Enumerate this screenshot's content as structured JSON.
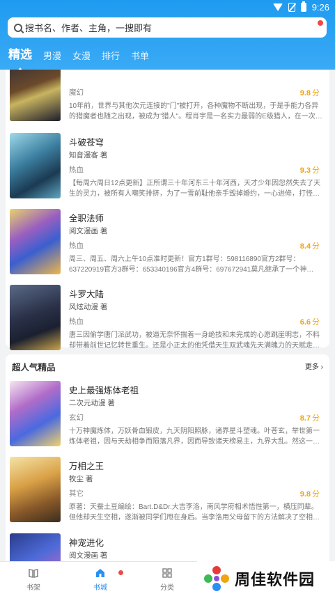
{
  "status": {
    "time": "9:26"
  },
  "search": {
    "placeholder": "搜书名、作者、主角，一搜即有"
  },
  "tabs": [
    "精选",
    "男漫",
    "女漫",
    "排行",
    "书单"
  ],
  "featured": [
    {
      "title": "",
      "author": "",
      "genre": "魔幻",
      "score": "9.8",
      "desc": "10年前，世界与其他次元连接的\"门\"被打开，各种魔物不断出现，于是手能力各异的猎魔者也随之出现，被成为\"猎人\"。程肖宇是一名实力最弱的E级猎人，在一次…"
    },
    {
      "title": "斗破苍穹",
      "author": "知音漫客 著",
      "genre": "热血",
      "score": "9.3",
      "desc": "【每周六周日12点更新】正所谓三十年河东三十年河西，天才少年因忽然失去了天生的灵力，被所有人嘲笑排挤，为了一雪前耻他亲手毁掉婚约，一心进修，打怪…"
    },
    {
      "title": "全职法师",
      "author": "阅文漫画 著",
      "genre": "热血",
      "score": "8.4",
      "desc": "周三、周五、周六上午10点准时更新！官方1群号：598116890官方2群号：637220919官方3群号：653340196官方4群号：697672941莫凡继承了一个神…"
    },
    {
      "title": "斗罗大陆",
      "author": "风炫动漫 著",
      "genre": "热血",
      "score": "6.6",
      "desc": "唐三因偷学唐门派武功，被逼无奈怀揣着一身绝技和未完成的心愿跳崖明志，不料却带着前世记忆转世重生。还是小正太的他凭借天生双武魂先天满魄力的天赋走…"
    }
  ],
  "popular": {
    "title": "超人气精品",
    "more": "更多",
    "books": [
      {
        "title": "史上最强炼体老祖",
        "author": "二次元动漫 著",
        "genre": "玄幻",
        "score": "8.7",
        "desc": "十万神魔炼体，万妖骨血锻皮，九天阴阳照脉，诸界星斗塑魂。叶苍玄，举世第一炼体老祖，因与天劫相争而陨落凡界，因而导致诸天榜易主，九界大乱。然这一…"
      },
      {
        "title": "万相之王",
        "author": "牧尘 著",
        "genre": "其它",
        "score": "9.8",
        "desc": "原著：天蚕土豆编绘：Bart.D&Dr.大吉李洛，南风学府相术悟性第一，横压同辈。但他却天生空相，遂渐被同学们甩在身后。当李洛用父母留下的方法解决了空相…"
      },
      {
        "title": "神宠进化",
        "author": "阅文漫画 著",
        "genre": "",
        "score": "",
        "desc": ""
      }
    ]
  },
  "score_unit": "分",
  "bottom_nav": {
    "shelf": "书架",
    "city": "书城",
    "category": "分类"
  },
  "brand": {
    "name": "周佳软件园"
  },
  "colors": {
    "primary": "#1e9bf0",
    "score": "#f0a411",
    "badge": "#f04848"
  }
}
